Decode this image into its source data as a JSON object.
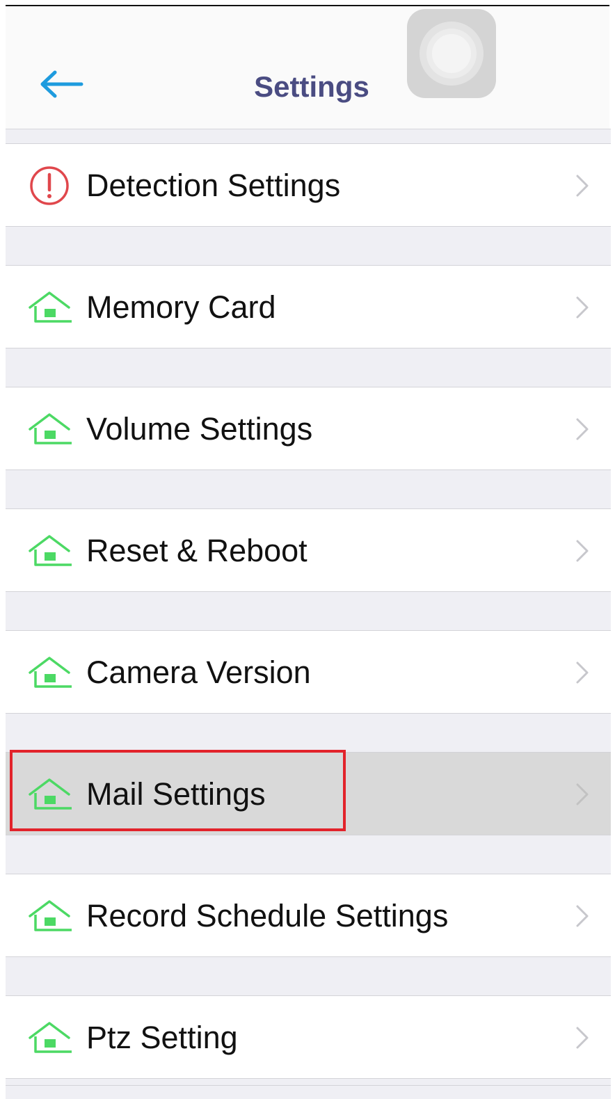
{
  "header": {
    "title": "Settings",
    "back_icon": "arrow-left-icon",
    "back_icon_color": "#1e9bde",
    "title_color": "#4a4c82"
  },
  "assistive_touch": {
    "icon": "assistive-touch-icon"
  },
  "settings": {
    "items": [
      {
        "label": "Detection Settings",
        "icon": "alert-circle-icon",
        "icon_color": "#e0474c"
      },
      {
        "label": "Memory Card",
        "icon": "house-icon",
        "icon_color": "#4cd964"
      },
      {
        "label": "Volume Settings",
        "icon": "house-icon",
        "icon_color": "#4cd964"
      },
      {
        "label": "Reset & Reboot",
        "icon": "house-icon",
        "icon_color": "#4cd964"
      },
      {
        "label": "Camera Version",
        "icon": "house-icon",
        "icon_color": "#4cd964"
      },
      {
        "label": "Mail Settings",
        "icon": "house-icon",
        "icon_color": "#4cd964",
        "selected": true
      },
      {
        "label": "Record Schedule Settings",
        "icon": "house-icon",
        "icon_color": "#4cd964"
      },
      {
        "label": "Ptz Setting",
        "icon": "house-icon",
        "icon_color": "#4cd964"
      }
    ]
  },
  "highlight": {
    "color": "#e2232b",
    "target": "Mail Settings"
  }
}
